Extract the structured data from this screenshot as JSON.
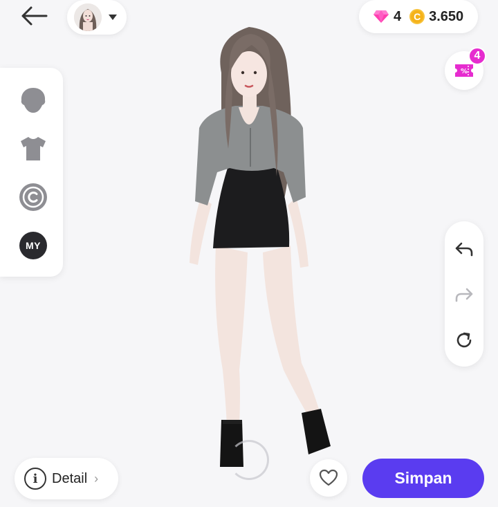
{
  "header": {
    "back_icon": "arrow-left-icon",
    "avatar_selector_icon": "caret-down-icon"
  },
  "currency": {
    "diamond_icon": "diamond-icon",
    "diamonds": "4",
    "coin_icon": "coin-icon",
    "coin_symbol": "C",
    "coins": "3.650"
  },
  "coupon": {
    "icon": "coupon-icon",
    "badge_count": "4"
  },
  "categories": [
    {
      "name": "head",
      "icon": "head-icon"
    },
    {
      "name": "clothes",
      "icon": "shirt-icon"
    },
    {
      "name": "copyright",
      "icon": "copyright-icon"
    },
    {
      "name": "my",
      "label": "MY"
    }
  ],
  "history": [
    {
      "name": "undo",
      "icon": "undo-icon"
    },
    {
      "name": "redo",
      "icon": "redo-icon"
    },
    {
      "name": "reset",
      "icon": "refresh-icon"
    }
  ],
  "footer": {
    "detail_label": "Detail",
    "detail_icon": "info-icon",
    "info_glyph": "i",
    "chevron": "›",
    "favorite_icon": "heart-icon",
    "save_label": "Simpan"
  },
  "colors": {
    "accent": "#5a3cf0",
    "badge": "#e62ccf",
    "coin": "#f5b21a",
    "diamond": "#ff3fb0"
  }
}
